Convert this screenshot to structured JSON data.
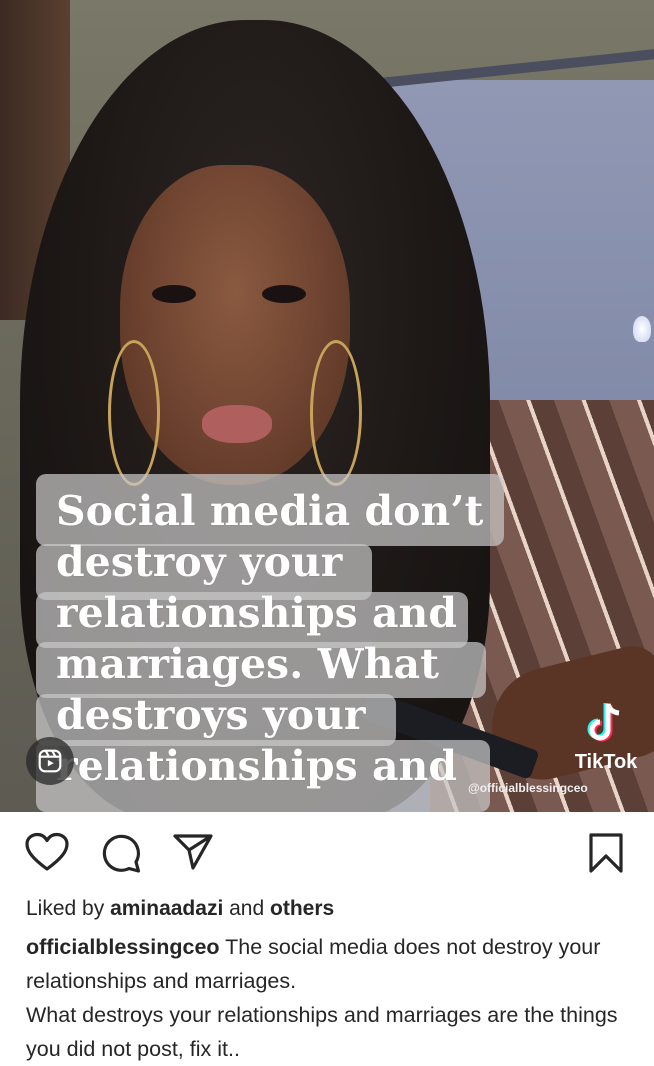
{
  "post": {
    "caption_overlay_lines": [
      "Social media don’t",
      "destroy your",
      "relationships and",
      "marriages. What",
      "destroys your",
      "relationships and"
    ],
    "watermark": {
      "brand": "TikTok",
      "handle": "@officialblessingceo"
    },
    "reels_icon": "reels-icon"
  },
  "actions": {
    "icons": [
      "heart-icon",
      "comment-icon",
      "share-icon",
      "bookmark-icon"
    ]
  },
  "likes": {
    "prefix": "Liked by ",
    "user": "aminaadazi",
    "middle": " and ",
    "others": "others"
  },
  "caption": {
    "username": "officialblessingceo",
    "line1": " The social media does not destroy your relationships and marriages.",
    "line2": "What destroys your relationships and marriages are the things you did not post, fix it.."
  }
}
